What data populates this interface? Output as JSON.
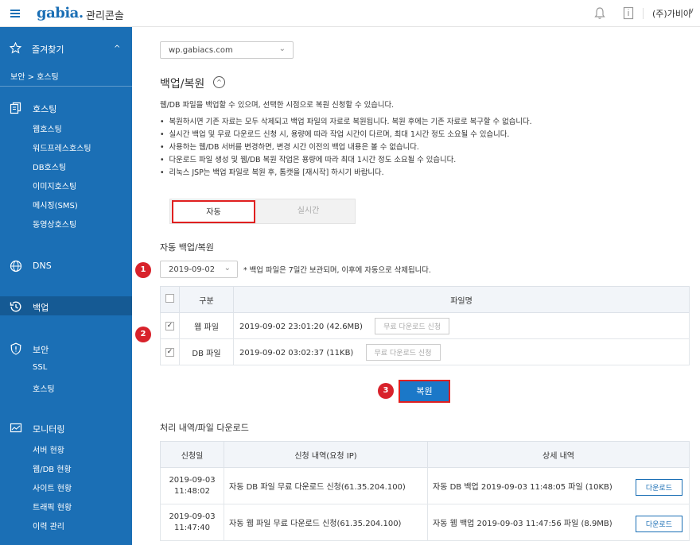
{
  "topbar": {
    "logo": "gabia.",
    "console_title": "관리콘솔",
    "account": "(주)가비아",
    "account_chevron": "∨"
  },
  "sidebar": {
    "favorites_label": "즐겨찾기",
    "favorites_chevron": "^",
    "breadcrumb": "보안 > 호스팅",
    "hosting": {
      "label": "호스팅",
      "items": [
        "웹호스팅",
        "워드프레스호스팅",
        "DB호스팅",
        "이미지호스팅",
        "메시징(SMS)",
        "동영상호스팅"
      ]
    },
    "dns_label": "DNS",
    "backup_label": "백업",
    "security": {
      "label": "보안",
      "items": [
        "SSL",
        "호스팅"
      ]
    },
    "monitoring": {
      "label": "모니터링",
      "items": [
        "서버 현황",
        "웹/DB 현황",
        "사이트 현황",
        "트래픽 현황",
        "이력 관리"
      ]
    }
  },
  "main": {
    "store_select": "wp.gabiacs.com",
    "title": "백업/복원",
    "title_toggle": "^",
    "intro": "웹/DB 파일을 백업할 수 있으며, 선택한 시점으로 복원 신청할 수 있습니다.",
    "bullets": [
      "복원하시면 기존 자료는 모두 삭제되고 백업 파일의 자료로 복원됩니다. 복원 후에는 기존 자료로 복구할 수 없습니다.",
      "실시간 백업 및 무료 다운로드 신청 시, 용량에 따라 작업 시간이 다르며, 최대 1시간 정도 소요될 수 있습니다.",
      "사용하는 웹/DB 서버를 변경하면, 변경 시간 이전의 백업 내용은 볼 수 없습니다.",
      "다운로드 파일 생성 및 웹/DB 복원 작업은 용량에 따라 최대 1시간 정도 소요될 수 있습니다.",
      "리눅스 JSP는 백업 파일로 복원 후, 톰캣을 [재시작] 하시기 바랍니다."
    ],
    "tabs": [
      {
        "label": "자동",
        "active": true
      },
      {
        "label": "실시간",
        "active": false
      }
    ],
    "auto_section_title": "자동 백업/복원",
    "date_select": "2019-09-02",
    "date_note": "* 백업 파일은 7일간 보관되며, 이후에 자동으로 삭제됩니다.",
    "steps": [
      "1",
      "2",
      "3"
    ],
    "backup_table": {
      "headers": [
        "구분",
        "파일명"
      ],
      "rows": [
        {
          "type": "웹 파일",
          "file": "2019-09-02 23:01:20 (42.6MB)",
          "button": "무료 다운로드 신청",
          "checked": true
        },
        {
          "type": "DB 파일",
          "file": "2019-09-02 03:02:37 (11KB)",
          "button": "무료 다운로드 신청",
          "checked": true
        }
      ]
    },
    "restore_button": "복원",
    "history_title": "처리 내역/파일 다운로드",
    "history_table": {
      "headers": [
        "신청일",
        "신청 내역(요청 IP)",
        "상세 내역"
      ],
      "rows": [
        {
          "date": "2019-09-03",
          "time": "11:48:02",
          "request": "자동 DB 파일 무료 다운로드 신청(61.35.204.100)",
          "detail": "자동 DB 백업 2019-09-03 11:48:05 파일 (10KB)",
          "button": "다운로드"
        },
        {
          "date": "2019-09-03",
          "time": "11:47:40",
          "request": "자동 웹 파일 무료 다운로드 신청(61.35.204.100)",
          "detail": "자동 웹 백업 2019-09-03 11:47:56 파일 (8.9MB)",
          "button": "다운로드"
        }
      ]
    }
  },
  "colors": {
    "sidebar": "#1b6fb5",
    "sidebar_active": "#155a94",
    "primary_button": "#1b78c8",
    "highlight_border": "#e02020",
    "step_badge": "#d8222b"
  }
}
